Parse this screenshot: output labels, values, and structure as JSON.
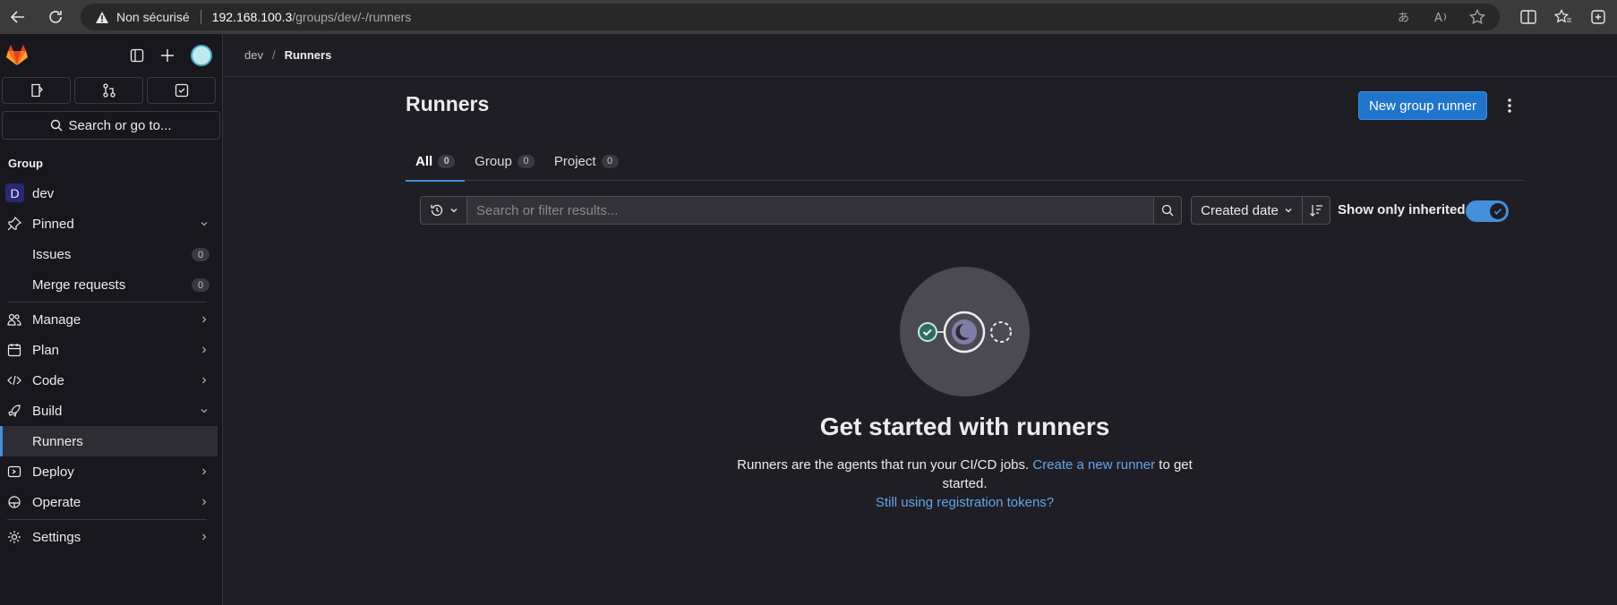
{
  "browser": {
    "security_label": "Non sécurisé",
    "url_host": "192.168.100.3",
    "url_path": "/groups/dev/-/runners"
  },
  "sidebar": {
    "search_label": "Search or go to...",
    "section_label": "Group",
    "group": {
      "letter": "D",
      "name": "dev"
    },
    "pinned_label": "Pinned",
    "pinned_items": [
      {
        "label": "Issues",
        "count": "0"
      },
      {
        "label": "Merge requests",
        "count": "0"
      }
    ],
    "nav": [
      {
        "label": "Manage",
        "icon": "users-icon"
      },
      {
        "label": "Plan",
        "icon": "calendar-icon"
      },
      {
        "label": "Code",
        "icon": "code-icon"
      },
      {
        "label": "Build",
        "icon": "rocket-icon"
      }
    ],
    "build_sub": [
      {
        "label": "Runners"
      }
    ],
    "nav2": [
      {
        "label": "Deploy",
        "icon": "deploy-icon"
      },
      {
        "label": "Operate",
        "icon": "cloud-icon"
      }
    ],
    "settings_label": "Settings"
  },
  "breadcrumb": {
    "items": [
      "dev",
      "Runners"
    ]
  },
  "page": {
    "title": "Runners",
    "new_button": "New group runner",
    "tabs": [
      {
        "label": "All",
        "count": "0"
      },
      {
        "label": "Group",
        "count": "0"
      },
      {
        "label": "Project",
        "count": "0"
      }
    ],
    "search_placeholder": "Search or filter results...",
    "sort_label": "Created date",
    "inherited_label": "Show only inherited",
    "inherited_on": true
  },
  "empty_state": {
    "title": "Get started with runners",
    "desc_before": "Runners are the agents that run your CI/CD jobs.",
    "desc_link": "Create a new runner",
    "desc_after": "to get started.",
    "secondary_link": "Still using registration tokens?"
  },
  "colors": {
    "accent": "#428fdc",
    "primary_button": "#1f75cb",
    "link": "#63a6e9"
  }
}
